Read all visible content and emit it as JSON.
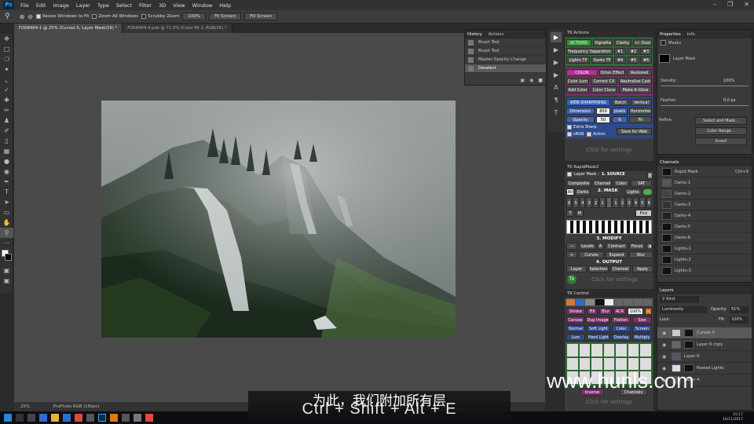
{
  "app": {
    "logo": "Ps",
    "window_controls": [
      "–",
      "❐",
      "✕"
    ]
  },
  "menu": [
    "File",
    "Edit",
    "Image",
    "Layer",
    "Type",
    "Select",
    "Filter",
    "3D",
    "View",
    "Window",
    "Help"
  ],
  "options_bar": {
    "resize_windows": "Resize Windows to Fit",
    "zoom_all": "Zoom All Windows",
    "scrubby": "Scrubby Zoom",
    "zoom_pct": "100%",
    "fit_screen": "Fit Screen",
    "fill_screen": "Fill Screen"
  },
  "doc_tabs": [
    "FOX8464-1 @ 25% (Curves 5, Layer Mask/16) *",
    "FOX8464-4.psb @ 71.5% (Color fill 1, RGB/16) *"
  ],
  "status": {
    "zoom": "25%",
    "profile": "ProPhoto RGB (16bpc)"
  },
  "history": {
    "tabs": [
      "History",
      "Actions"
    ],
    "items": [
      "Brush Tool",
      "Brush Tool",
      "Master Opacity Change",
      "Deselect"
    ]
  },
  "tk_actions": {
    "title": "TK Actions",
    "actions_label": "ACTIONS",
    "vignette": "Vignette",
    "clarity": "Clarity",
    "dust": "+/- Dust",
    "freq_sep": "Frequency Separation",
    "n1": "#1",
    "n2": "#2",
    "n3": "#3",
    "lights_tp": "Lights TP",
    "darks_tp": "Darks TP",
    "n4": "#4",
    "n5": "#5",
    "n6": "#6",
    "color_label": "COLOR",
    "orton": "Orton Effect",
    "restored": "Restored Orton",
    "color_lum": "Color Lum",
    "correct_ca": "Correct CA",
    "neutralize": "Neutralize Cast",
    "add_color": "Add Color",
    "color_clone": "Color Clone",
    "make_glow": "Make-It-Glow",
    "web_label": "WEB-SHARPENING",
    "batch": "Batch",
    "vertical": "Vertical",
    "dimension": "Dimension",
    "dim_val": "800",
    "pixels": "pixels",
    "horizontal": "Horizontal",
    "opacity": "Opacity",
    "op_val": "50",
    "pct": "%",
    "fit": "Fit",
    "extra_sharp": "Extra Sharp",
    "srgb": "sRGB",
    "action": "Action",
    "save_web": "Save for Web",
    "click_settings": "Click for settings"
  },
  "tk_rapidmask": {
    "title": "TK RapidMask2",
    "layer_mask": "Layer Mask -",
    "source": "1. SOURCE",
    "composite": "Composite",
    "channel": "Channel",
    "color": "Color",
    "sat": "SAT",
    "all": "All",
    "darks": "Darks",
    "mask": "2. MASK",
    "lights": "Lights",
    "nums": [
      "6",
      "5",
      "4",
      "3",
      "2",
      "1",
      "",
      "1",
      "2",
      "3",
      "4",
      "5",
      "6"
    ],
    "t": "T",
    "m": "M",
    "pick": "Pick",
    "modify": "3. MODIFY",
    "levels": "Levels",
    "a": "A",
    "contract": "Contract",
    "focus": "Focus",
    "curves": "Curves",
    "expand": "Expand",
    "blur": "Blur",
    "output": "4. OUTPUT",
    "layer": "Layer",
    "selection": "Selection",
    "out_channel": "Channel",
    "apply": "Apply",
    "click_settings": "Click for settings"
  },
  "tk_control": {
    "title": "TK Control",
    "stroke": "Stroke",
    "fill": "Fill",
    "blur": "Blur",
    "acr": "ACR",
    "pct100": "100%",
    "canvas": "Canvas",
    "dup_image": "Dup Image",
    "flatten": "Flatten",
    "size": "Size",
    "normal": "Normal",
    "soft_light": "Soft Light",
    "color": "Color",
    "screen": "Screen",
    "lum": "Lum",
    "hard_light": "Hard Light",
    "overlay": "Overlay",
    "multiply": "Multiply",
    "inverse": "Inverse",
    "channels": "Channels",
    "click_settings": "Click for settings"
  },
  "properties": {
    "tabs": [
      "Properties",
      "Info"
    ],
    "masks": "Masks",
    "layer_mask": "Layer Mask",
    "density": "Density:",
    "density_val": "100%",
    "feather": "Feather:",
    "feather_val": "0,0 px",
    "refine": "Refine:",
    "select_mask": "Select and Mask...",
    "color_range": "Color Range...",
    "invert": "Invert"
  },
  "channels": {
    "title": "Channels",
    "items": [
      {
        "name": "Rapid Mask",
        "shortcut": "Ctrl+9"
      },
      {
        "name": "Darks-1"
      },
      {
        "name": "Darks-2"
      },
      {
        "name": "Darks-3"
      },
      {
        "name": "Darks-4"
      },
      {
        "name": "Darks-5"
      },
      {
        "name": "Darks-6"
      },
      {
        "name": "Lights-1"
      },
      {
        "name": "Lights-2"
      },
      {
        "name": "Lights-3"
      }
    ]
  },
  "layers": {
    "title": "Layers",
    "kind": "Kind",
    "blend": "Luminosity",
    "opacity_label": "Opacity:",
    "opacity": "51%",
    "lock": "Lock:",
    "fill_label": "Fill:",
    "fill": "100%",
    "items": [
      "Curves 5",
      "Layer 6 copy",
      "Layer 6",
      "Pasted Lights",
      "Layer 4"
    ]
  },
  "subtitle": {
    "cn": "为此，我们附加所有层",
    "en": "Ctrl + Shift + Alt + E"
  },
  "watermark": "www.hunls.com",
  "clock": {
    "time": "15:17",
    "date": "16/11/2017"
  }
}
